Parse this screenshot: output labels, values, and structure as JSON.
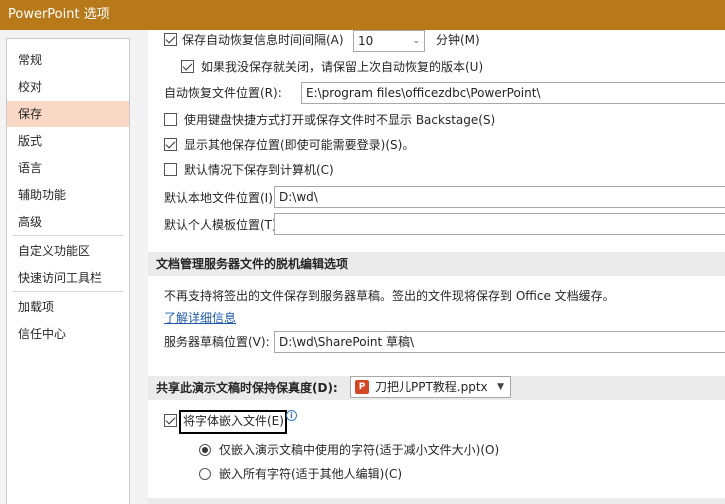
{
  "window": {
    "title": "PowerPoint 选项"
  },
  "sidebar": {
    "items": [
      {
        "label": "常规"
      },
      {
        "label": "校对"
      },
      {
        "label": "保存"
      },
      {
        "label": "版式"
      },
      {
        "label": "语言"
      },
      {
        "label": "辅助功能"
      },
      {
        "label": "高级"
      },
      {
        "label": "自定义功能区"
      },
      {
        "label": "快速访问工具栏"
      },
      {
        "label": "加载项"
      },
      {
        "label": "信任中心"
      }
    ],
    "active": "保存"
  },
  "save": {
    "autorecover_interval_label": "保存自动恢复信息时间间隔(A)",
    "autorecover_interval_value": "10",
    "autorecover_interval_unit": "分钟(M)",
    "keep_last_version_label": "如果我没保存就关闭，请保留上次自动恢复的版本(U)",
    "autorecover_location_label": "自动恢复文件位置(R):",
    "autorecover_location_value": "E:\\program files\\officezdbc\\PowerPoint\\",
    "no_backstage_label": "使用键盘快捷方式打开或保存文件时不显示 Backstage(S)",
    "show_other_locations_label": "显示其他保存位置(即使可能需要登录)(S)。",
    "save_to_computer_label": "默认情况下保存到计算机(C)",
    "default_local_label": "默认本地文件位置(I):",
    "default_local_value": "D:\\wd\\",
    "default_template_label": "默认个人模板位置(T):",
    "default_template_value": ""
  },
  "offline": {
    "header": "文档管理服务器文件的脱机编辑选项",
    "note": "不再支持将签出的文件保存到服务器草稿。签出的文件现将保存到 Office 文档缓存。",
    "learn_more": "了解详细信息",
    "drafts_label": "服务器草稿位置(V):",
    "drafts_value": "D:\\wd\\SharePoint 草稿\\"
  },
  "fidelity": {
    "header": "共享此演示文稿时保持保真度(D):",
    "file": "刀把儿PPT教程.pptx",
    "embed_fonts_label": "将字体嵌入文件(E)",
    "embed_used_label": "仅嵌入演示文稿中使用的字符(适于减小文件大小)(O)",
    "embed_all_label": "嵌入所有字符(适于其他人编辑)(C)"
  }
}
